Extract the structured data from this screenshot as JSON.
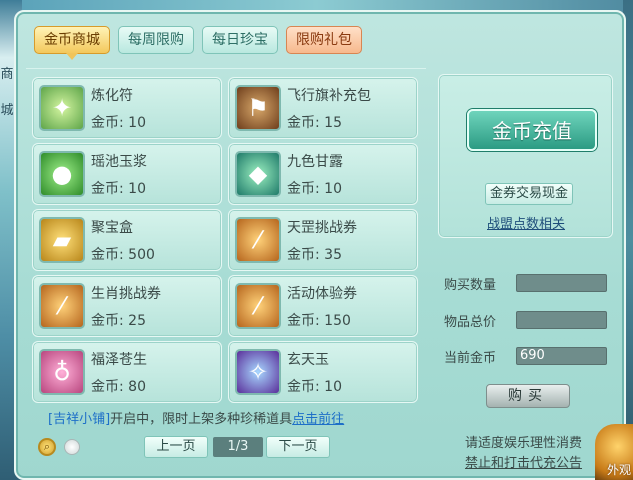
{
  "side": {
    "chars": [
      "商",
      "城"
    ]
  },
  "tabs": [
    {
      "label": "金币商城",
      "active": true
    },
    {
      "label": "每周限购"
    },
    {
      "label": "每日珍宝"
    },
    {
      "label": "限购礼包"
    }
  ],
  "currency_label": "金币: ",
  "items": [
    {
      "name": "炼化符",
      "price": "10",
      "icon": "talisman-icon"
    },
    {
      "name": "飞行旗补充包",
      "price": "15",
      "icon": "flag-pack-icon"
    },
    {
      "name": "瑶池玉浆",
      "price": "10",
      "icon": "jade-jar-icon"
    },
    {
      "name": "九色甘露",
      "price": "10",
      "icon": "dew-gem-icon"
    },
    {
      "name": "聚宝盒",
      "price": "500",
      "icon": "treasure-box-icon"
    },
    {
      "name": "天罡挑战券",
      "price": "35",
      "icon": "scroll-icon"
    },
    {
      "name": "生肖挑战券",
      "price": "25",
      "icon": "scroll-icon"
    },
    {
      "name": "活动体验券",
      "price": "150",
      "icon": "scroll-icon"
    },
    {
      "name": "福泽苍生",
      "price": "80",
      "icon": "potion-bottle-icon"
    },
    {
      "name": "玄天玉",
      "price": "10",
      "icon": "purple-jade-icon"
    }
  ],
  "notice": {
    "shop": "[吉祥小铺]",
    "text": "开启中，限时上架多种珍稀道具",
    "link": "点击前往"
  },
  "pager": {
    "prev": "上一页",
    "page": "1/3",
    "next": "下一页"
  },
  "right": {
    "recharge": "金币充值",
    "exchange": "金券交易现金",
    "alliance": "战盟点数相关"
  },
  "form": {
    "qty_label": "购买数量",
    "qty_value": "",
    "total_label": "物品总价",
    "total_value": "",
    "gold_label": "当前金币",
    "gold_value": "690",
    "buy": "购买"
  },
  "footer": {
    "line1": "请适度娱乐理性消费",
    "line2": "禁止和打击代充公告"
  },
  "corner": {
    "label": "外观"
  }
}
